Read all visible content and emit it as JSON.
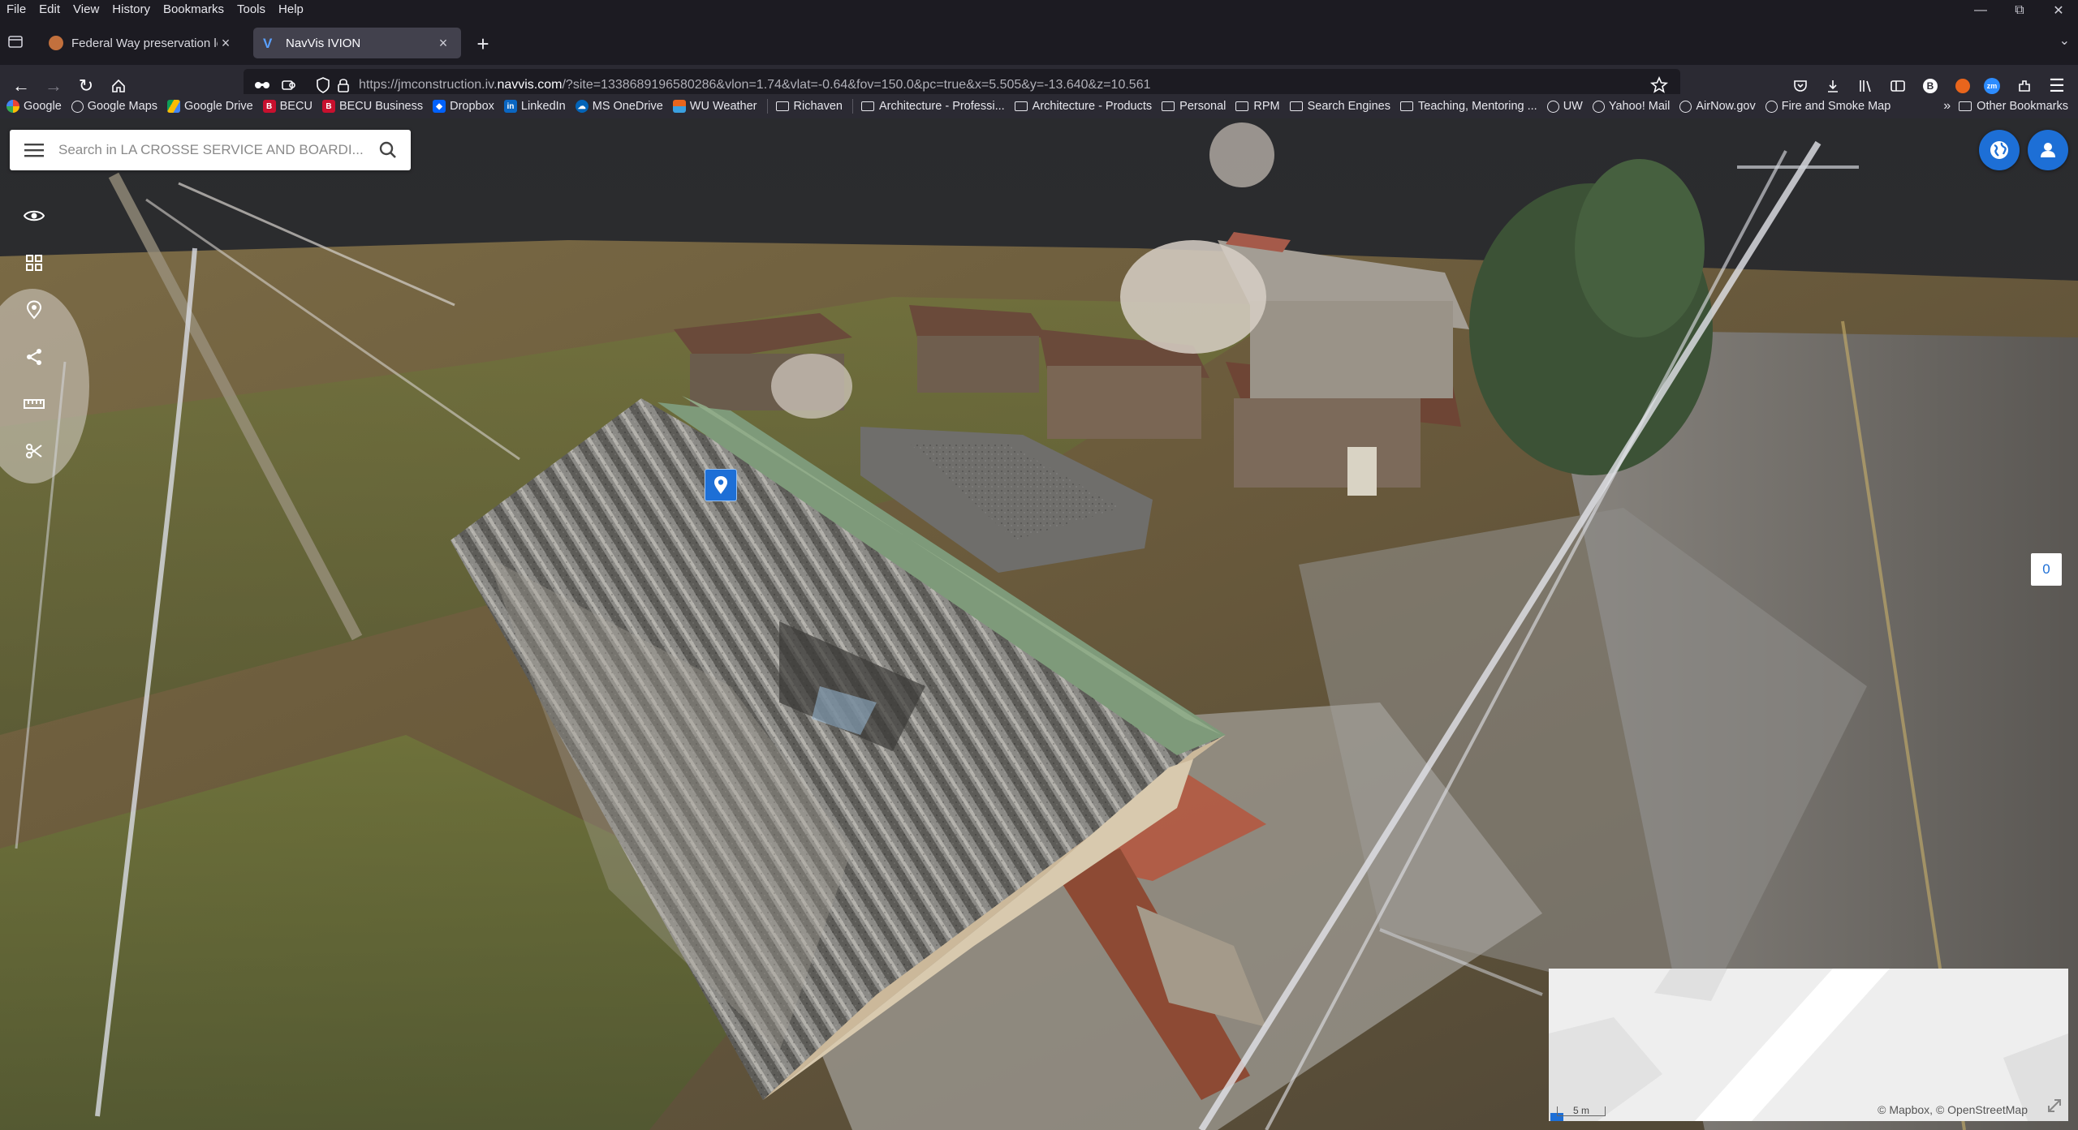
{
  "menubar": {
    "items": [
      "File",
      "Edit",
      "View",
      "History",
      "Bookmarks",
      "Tools",
      "Help"
    ]
  },
  "tabs": [
    {
      "label": "Federal Way preservation legisl",
      "active": false
    },
    {
      "label": "NavVis IVION",
      "active": true
    }
  ],
  "navbar": {
    "url_prefix": "https://jmconstruction.iv.",
    "url_domain": "navvis.com",
    "url_rest": "/?site=1338689196580286&vlon=1.74&vlat=-0.64&fov=150.0&pc=true&x=5.505&y=-13.640&z=10.561"
  },
  "bookmarks": [
    {
      "label": "Google",
      "icon": "google-icon",
      "kind": "site"
    },
    {
      "label": "Google Maps",
      "icon": "globe-icon",
      "kind": "site"
    },
    {
      "label": "Google Drive",
      "icon": "drive-icon",
      "kind": "site"
    },
    {
      "label": "BECU",
      "icon": "becu-icon",
      "kind": "site"
    },
    {
      "label": "BECU Business",
      "icon": "becu-icon",
      "kind": "site"
    },
    {
      "label": "Dropbox",
      "icon": "dropbox-icon",
      "kind": "site"
    },
    {
      "label": "LinkedIn",
      "icon": "linkedin-icon",
      "kind": "site"
    },
    {
      "label": "MS OneDrive",
      "icon": "onedrive-icon",
      "kind": "site"
    },
    {
      "label": "WU Weather",
      "icon": "weather-icon",
      "kind": "site"
    },
    {
      "label": "Richaven",
      "icon": "folder-icon",
      "kind": "folder"
    },
    {
      "label": "Architecture - Professi...",
      "icon": "folder-icon",
      "kind": "folder"
    },
    {
      "label": "Architecture - Products",
      "icon": "folder-icon",
      "kind": "folder"
    },
    {
      "label": "Personal",
      "icon": "folder-icon",
      "kind": "folder"
    },
    {
      "label": "RPM",
      "icon": "folder-icon",
      "kind": "folder"
    },
    {
      "label": "Search Engines",
      "icon": "folder-icon",
      "kind": "folder"
    },
    {
      "label": "Teaching, Mentoring ...",
      "icon": "folder-icon",
      "kind": "folder"
    },
    {
      "label": "UW",
      "icon": "globe-icon",
      "kind": "site"
    },
    {
      "label": "Yahoo! Mail",
      "icon": "globe-icon",
      "kind": "site"
    },
    {
      "label": "AirNow.gov",
      "icon": "globe-icon",
      "kind": "site"
    },
    {
      "label": "Fire and Smoke Map",
      "icon": "globe-icon",
      "kind": "site"
    }
  ],
  "other_bookmarks": "Other Bookmarks",
  "app": {
    "search_placeholder": "Search in LA CROSSE SERVICE AND BOARDI...",
    "counter": "0",
    "map_attribution": "© Mapbox, © OpenStreetMap",
    "map_scale": "5 m"
  },
  "colors": {
    "accent": "#1d6fd6",
    "browser_dark": "#1c1b22",
    "toolbar": "#2b2a33"
  }
}
